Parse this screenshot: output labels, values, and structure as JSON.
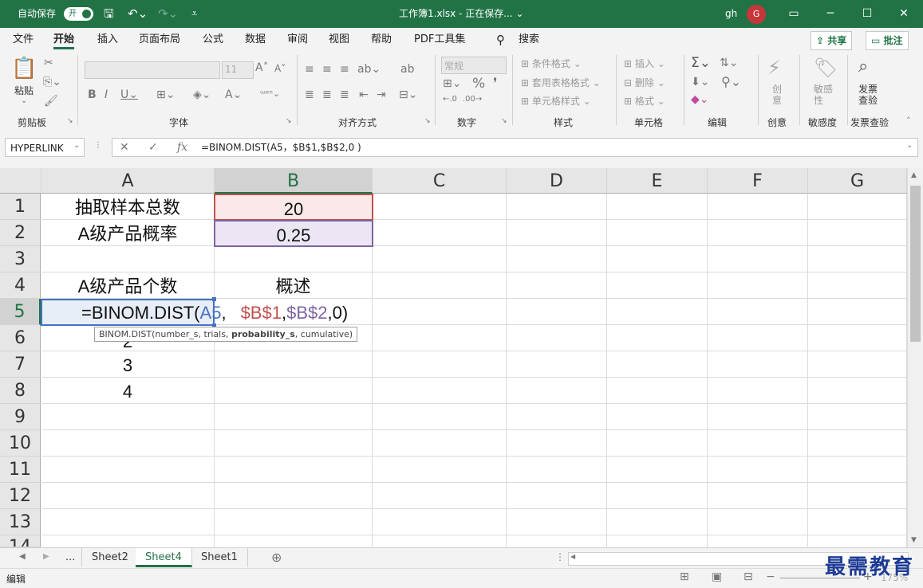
{
  "titlebar": {
    "autosave_label": "自动保存",
    "autosave_state": "开",
    "doc_title": "工作簿1.xlsx - 正在保存... ⌄",
    "user_initials": "gh",
    "avatar_letter": "G"
  },
  "menu": {
    "tabs": [
      "文件",
      "开始",
      "插入",
      "页面布局",
      "公式",
      "数据",
      "审阅",
      "视图",
      "帮助",
      "PDF工具集"
    ],
    "search": "搜索",
    "share": "共享",
    "comments": "批注"
  },
  "ribbon": {
    "clipboard": {
      "paste": "粘贴",
      "label": "剪贴板"
    },
    "font": {
      "size": "11",
      "label": "字体"
    },
    "alignment": {
      "label": "对齐方式"
    },
    "number": {
      "format": "常规",
      "label": "数字"
    },
    "styles": {
      "conditional": "条件格式",
      "table": "套用表格格式",
      "cell_styles": "单元格样式",
      "label": "样式"
    },
    "cells": {
      "insert": "插入",
      "delete": "删除",
      "format": "格式",
      "label": "单元格"
    },
    "editing": {
      "label": "编辑"
    },
    "creativity": {
      "btn": "创意",
      "label": "创意"
    },
    "sensitivity": {
      "btn": "敏感性",
      "label": "敏感度"
    },
    "invoice": {
      "btn": "发票查验",
      "label": "发票查验"
    }
  },
  "formula_bar": {
    "name_box": "HYPERLINK",
    "formula": "=BINOM.DIST(A5，$B$1,$B$2,0 )"
  },
  "sheet": {
    "columns": [
      "A",
      "B",
      "C",
      "D",
      "E",
      "F",
      "G"
    ],
    "rows": [
      "1",
      "2",
      "3",
      "4",
      "5",
      "6",
      "7",
      "8",
      "9",
      "10",
      "11",
      "12",
      "13",
      "14"
    ],
    "a1": "抽取样本总数",
    "b1": "20",
    "a2": "A级产品概率",
    "b2": "0.25",
    "a4": "A级产品个数",
    "b4": "概述",
    "a6": "2",
    "a7": "3",
    "a8": "4",
    "edit": {
      "prefix": "=BINOM.DIST(",
      "ref1": "A5",
      "comma1": ",",
      "ref2": "$B$1",
      "comma2": ",",
      "ref3": "$B$2",
      "suffix": ",0)"
    },
    "tooltip": {
      "prefix": "BINOM.DIST(number_s, trials, ",
      "bold": "probability_s",
      "suffix": ", cumulative)"
    }
  },
  "sheet_tabs": {
    "ellipsis": "...",
    "tabs": [
      "Sheet2",
      "Sheet4",
      "Sheet1"
    ],
    "active_index": 1
  },
  "status": {
    "mode": "编辑",
    "zoom": "175%"
  },
  "watermark": "最需教育",
  "colors": {
    "excel_green": "#217346",
    "ref_blue": "#4472c4",
    "ref_red": "#c0504d",
    "ref_purple": "#8064a2"
  }
}
